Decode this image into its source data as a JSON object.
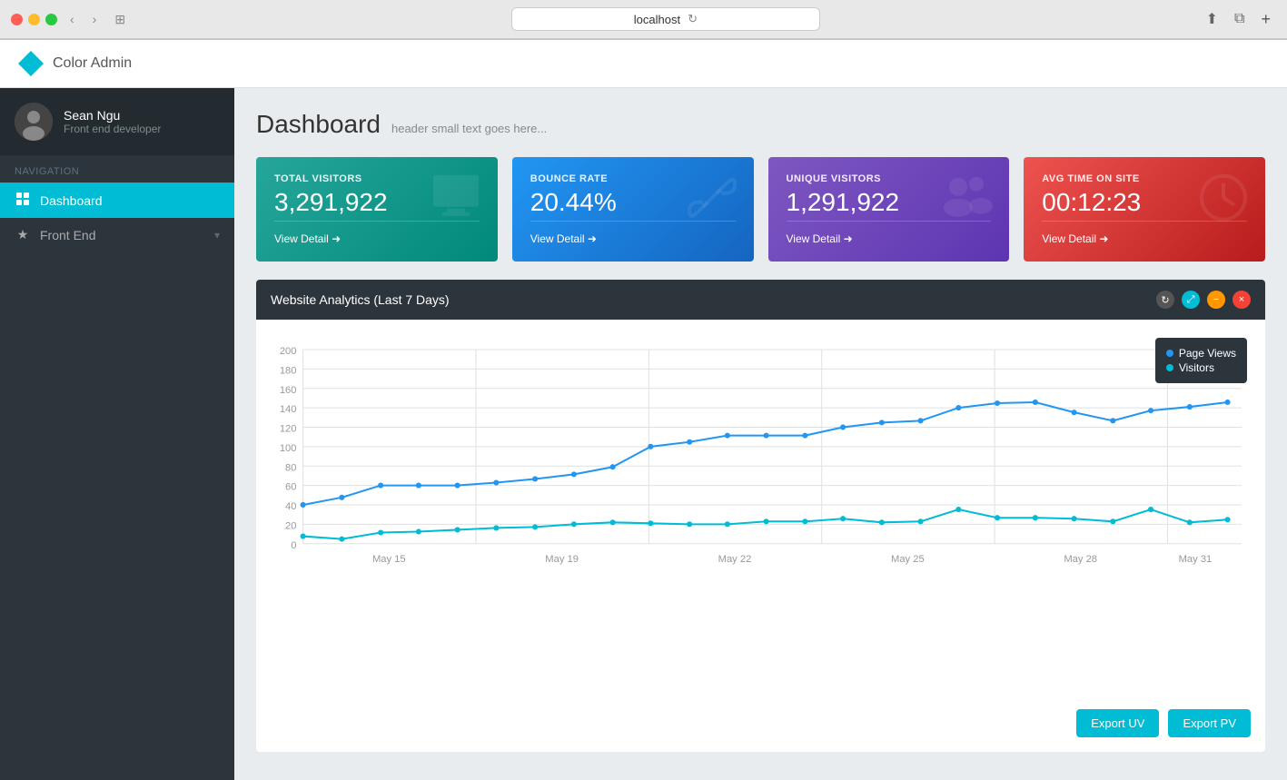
{
  "browser": {
    "url": "localhost",
    "reload_icon": "↻"
  },
  "app": {
    "title": "Color Admin"
  },
  "sidebar": {
    "user": {
      "name": "Sean Ngu",
      "role": "Front end developer",
      "avatar_emoji": "👤"
    },
    "nav_label": "Navigation",
    "items": [
      {
        "id": "dashboard",
        "label": "Dashboard",
        "icon": "▣",
        "active": true,
        "has_arrow": false
      },
      {
        "id": "frontend",
        "label": "Front End",
        "icon": "★",
        "active": false,
        "has_arrow": true
      }
    ]
  },
  "page": {
    "title": "Dashboard",
    "subtitle": "header small text goes here..."
  },
  "stat_cards": [
    {
      "id": "total-visitors",
      "label": "TOTAL VISITORS",
      "value": "3,291,922",
      "icon": "🖥",
      "footer": "View Detail ➜",
      "color_class": "card-teal"
    },
    {
      "id": "bounce-rate",
      "label": "BOUNCE RATE",
      "value": "20.44%",
      "icon": "🔗",
      "footer": "View Detail ➜",
      "color_class": "card-blue"
    },
    {
      "id": "unique-visitors",
      "label": "UNIQUE VISITORS",
      "value": "1,291,922",
      "icon": "👥",
      "footer": "View Detail ➜",
      "color_class": "card-purple"
    },
    {
      "id": "avg-time",
      "label": "AVG TIME ON SITE",
      "value": "00:12:23",
      "icon": "🕐",
      "footer": "View Detail ➜",
      "color_class": "card-red"
    }
  ],
  "analytics": {
    "title": "Website Analytics (Last 7 Days)",
    "legend": {
      "page_views_label": "Page Views",
      "visitors_label": "Visitors"
    },
    "x_labels": [
      "May 15",
      "May 19",
      "May 22",
      "May 25",
      "May 28",
      "May 31"
    ],
    "y_labels": [
      "0",
      "20",
      "40",
      "60",
      "80",
      "100",
      "120",
      "140",
      "160",
      "180",
      "200"
    ],
    "page_views_data": [
      40,
      50,
      60,
      60,
      60,
      65,
      70,
      78,
      88,
      100,
      105,
      115,
      115,
      115,
      123,
      128,
      130,
      138,
      145,
      148,
      133,
      123,
      138,
      142,
      150
    ],
    "visitors_data": [
      8,
      5,
      13,
      14,
      16,
      17,
      18,
      20,
      22,
      21,
      20,
      20,
      22,
      22,
      24,
      21,
      22,
      30,
      24,
      24,
      23,
      20,
      30,
      20,
      22
    ],
    "export_uv_label": "Export UV",
    "export_pv_label": "Export PV"
  },
  "chart_controls": {
    "reload_icon": "↻",
    "resize_icon": "⤢",
    "minus_icon": "−",
    "close_icon": "×"
  }
}
